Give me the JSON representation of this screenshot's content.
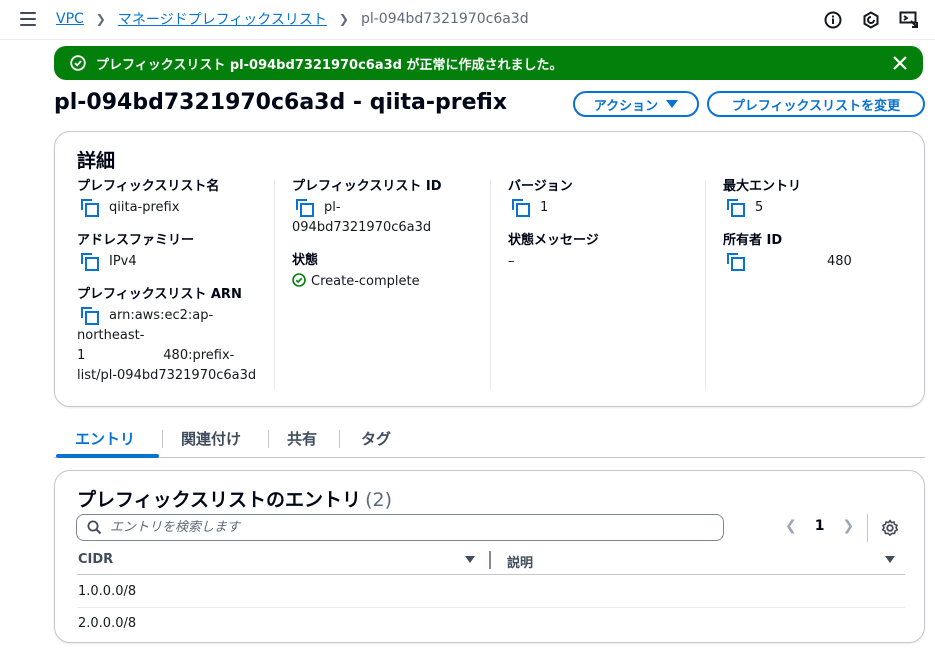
{
  "breadcrumb": {
    "vpc": "VPC",
    "managed_prefix_lists": "マネージドプレフィックスリスト",
    "current": "pl-094bd7321970c6a3d"
  },
  "flash": {
    "message": "プレフィックスリスト pl-094bd7321970c6a3d が正常に作成されました。",
    "color": "#037f0c"
  },
  "page": {
    "title": "pl-094bd7321970c6a3d - qiita-prefix",
    "action_button": "アクション",
    "modify_button": "プレフィックスリストを変更"
  },
  "details": {
    "heading": "詳細",
    "name_label": "プレフィックスリスト名",
    "name_value": "qiita-prefix",
    "family_label": "アドレスファミリー",
    "family_value": "IPv4",
    "arn_label": "プレフィックスリスト ARN",
    "arn_value_1": "arn:aws:ec2:ap-",
    "arn_value_2": "northeast-",
    "arn_value_3a": "1",
    "arn_value_3b": "480:prefix-",
    "arn_value_4": "list/pl-094bd7321970c6a3d",
    "id_label": "プレフィックスリスト ID",
    "id_value_1": "pl-",
    "id_value_2": "094bd7321970c6a3d",
    "state_label": "状態",
    "state_value": "Create-complete",
    "version_label": "バージョン",
    "version_value": "1",
    "state_message_label": "状態メッセージ",
    "state_message_value": "–",
    "max_entries_label": "最大エントリ",
    "max_entries_value": "5",
    "owner_label": "所有者 ID",
    "owner_value": "480"
  },
  "tabs": [
    "エントリ",
    "関連付け",
    "共有",
    "タグ"
  ],
  "entries": {
    "heading": "プレフィックスリストのエントリ",
    "count": "(2)",
    "search_placeholder": "エントリを検索します",
    "page_number": "1",
    "columns": [
      "CIDR",
      "説明"
    ],
    "rows": [
      {
        "cidr": "1.0.0.0/8",
        "description": ""
      },
      {
        "cidr": "2.0.0.0/8",
        "description": ""
      }
    ]
  },
  "colors": {
    "accent": "#0972d3",
    "success": "#037f0c"
  },
  "icons": {
    "menu": "hamburger-icon",
    "info": "info-icon",
    "notifications": "notification-icon",
    "feedback": "feedback-icon",
    "copy": "copy-icon",
    "settings": "gear-icon",
    "search": "search-icon"
  }
}
